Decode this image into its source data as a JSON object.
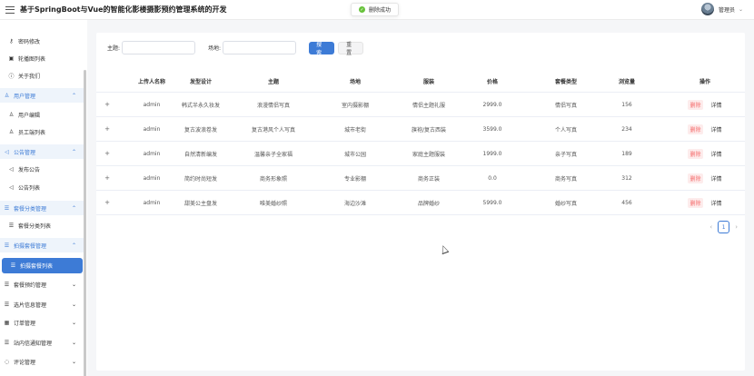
{
  "header": {
    "title": "基于SpringBoot与Vue的智能化影楼摄影预约管理系统的开发",
    "user_name": "管理员"
  },
  "toast": {
    "message": "删除成功"
  },
  "sidebar": {
    "items": [
      {
        "label": "密码修改",
        "icon": "key-icon",
        "kind": "sub"
      },
      {
        "label": "轮播图列表",
        "icon": "image-icon",
        "kind": "sub"
      },
      {
        "label": "关于我们",
        "icon": "info-icon",
        "kind": "sub"
      },
      {
        "label": "用户管理",
        "icon": "users-icon",
        "kind": "group",
        "chevron": "up"
      },
      {
        "label": "用户编辑",
        "icon": "user-icon",
        "kind": "sub"
      },
      {
        "label": "员工端列表",
        "icon": "user-icon",
        "kind": "sub"
      },
      {
        "label": "公告管理",
        "icon": "megaphone-icon",
        "kind": "group",
        "chevron": "up"
      },
      {
        "label": "发布公告",
        "icon": "megaphone-icon",
        "kind": "sub"
      },
      {
        "label": "公告列表",
        "icon": "megaphone-icon",
        "kind": "sub"
      },
      {
        "label": "套餐分类管理",
        "icon": "list-icon",
        "kind": "group",
        "chevron": "up"
      },
      {
        "label": "套餐分类列表",
        "icon": "list-icon",
        "kind": "sub"
      },
      {
        "label": "拍摄套餐管理",
        "icon": "list-icon",
        "kind": "group",
        "chevron": "up"
      },
      {
        "label": "拍摄套餐列表",
        "icon": "list-icon",
        "kind": "active"
      },
      {
        "label": "套餐预约管理",
        "icon": "list-icon",
        "kind": "top",
        "chevron": "down"
      },
      {
        "label": "选片信息管理",
        "icon": "list-icon",
        "kind": "top",
        "chevron": "down"
      },
      {
        "label": "订单管理",
        "icon": "calendar-icon",
        "kind": "top",
        "chevron": "down"
      },
      {
        "label": "站内信通知管理",
        "icon": "list-icon",
        "kind": "top",
        "chevron": "down"
      },
      {
        "label": "评论管理",
        "icon": "comment-icon",
        "kind": "top",
        "chevron": "down"
      }
    ]
  },
  "filters": {
    "theme_label": "主题:",
    "theme_value": "",
    "venue_label": "场地:",
    "venue_value": "",
    "search_label": "搜 索",
    "reset_label": "重 置"
  },
  "table": {
    "columns": [
      "上传人名称",
      "发型设计",
      "主题",
      "场地",
      "服装",
      "价格",
      "套餐类型",
      "浏览量",
      "操作"
    ],
    "rows": [
      {
        "expand": "+",
        "uploader": "admin",
        "style": "韩式半永久妆发",
        "theme": "浪漫情侣写真",
        "venue": "室内摄影棚",
        "costume": "情侣主题礼服",
        "price": "2999.0",
        "type": "情侣写真",
        "views": "156"
      },
      {
        "expand": "+",
        "uploader": "admin",
        "style": "复古波浪卷发",
        "theme": "复古港风个人写真",
        "venue": "城市老街",
        "costume": "旗袍/复古西装",
        "price": "3599.0",
        "type": "个人写真",
        "views": "234"
      },
      {
        "expand": "+",
        "uploader": "admin",
        "style": "自然清新编发",
        "theme": "温馨亲子全家福",
        "venue": "城市公园",
        "costume": "家庭主题服装",
        "price": "1999.0",
        "type": "亲子写真",
        "views": "189"
      },
      {
        "expand": "+",
        "uploader": "admin",
        "style": "简约时尚短发",
        "theme": "商务形象照",
        "venue": "专业影棚",
        "costume": "商务正装",
        "price": "0.0",
        "type": "商务写真",
        "views": "312"
      },
      {
        "expand": "+",
        "uploader": "admin",
        "style": "甜美公主盘发",
        "theme": "唯美婚纱照",
        "venue": "海边沙滩",
        "costume": "品牌婚纱",
        "price": "5999.0",
        "type": "婚纱写真",
        "views": "456"
      }
    ],
    "delete_label": "删除",
    "detail_label": "详情"
  },
  "pagination": {
    "prev": "‹",
    "current": "1",
    "next": "›"
  },
  "colors": {
    "primary": "#3d7bd6",
    "danger": "#f56c6c",
    "success": "#67c23a"
  }
}
